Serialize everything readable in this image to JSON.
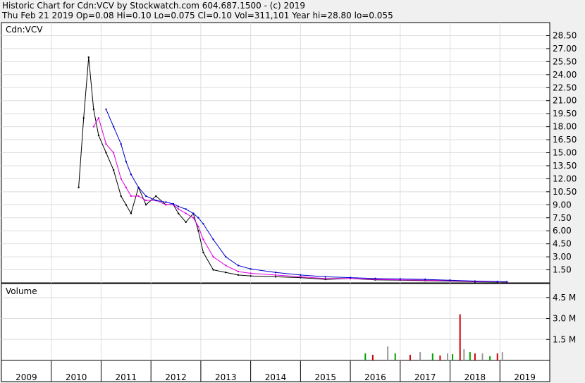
{
  "header": {
    "title": "Historic Chart for Cdn:VCV by Stockwatch.com 604.687.1500 - (c) 2019",
    "quote": "Thu Feb 21 2019   Op=0.08   Hi=0.10   Lo=0.075   Cl=0.10   Vol=311,101   Year hi=28.80   lo=0.055"
  },
  "chart_data": [
    {
      "type": "line",
      "panel": "price",
      "title": "Cdn:VCV",
      "ylim": [
        0,
        30
      ],
      "yticks": [
        "1.50",
        "3.00",
        "4.50",
        "6.00",
        "7.50",
        "9.00",
        "10.50",
        "12.00",
        "13.50",
        "15.00",
        "16.50",
        "18.00",
        "19.50",
        "21.00",
        "22.50",
        "24.00",
        "25.50",
        "27.00",
        "28.50"
      ],
      "x": [
        2010.55,
        2010.65,
        2010.75,
        2010.85,
        2010.95,
        2011.1,
        2011.25,
        2011.4,
        2011.5,
        2011.6,
        2011.75,
        2011.9,
        2012.1,
        2012.3,
        2012.45,
        2012.55,
        2012.7,
        2012.85,
        2012.95,
        2013.05,
        2013.25,
        2013.5,
        2013.75,
        2014.0,
        2014.5,
        2015.0,
        2015.5,
        2016.0,
        2016.5,
        2017.0,
        2017.5,
        2018.0,
        2018.5,
        2018.95,
        2019.14
      ],
      "series": [
        {
          "values": [
            11,
            19,
            26,
            20,
            17,
            15,
            13,
            10,
            9,
            8,
            11,
            9,
            10,
            9,
            9,
            8,
            7,
            8,
            6,
            3.5,
            1.5,
            1.2,
            0.9,
            0.8,
            0.7,
            0.6,
            0.4,
            0.5,
            0.35,
            0.3,
            0.25,
            0.2,
            0.12,
            0.1,
            0.1
          ]
        },
        {
          "values": [
            null,
            null,
            null,
            18,
            19,
            16,
            15,
            12,
            11,
            10,
            10,
            9.5,
            9.5,
            9,
            9,
            8.5,
            8,
            7.5,
            6.5,
            5,
            3,
            2,
            1.3,
            1.1,
            0.9,
            0.7,
            0.5,
            0.5,
            0.4,
            0.35,
            0.3,
            0.25,
            0.15,
            0.12,
            0.1
          ]
        },
        {
          "values": [
            null,
            null,
            null,
            null,
            null,
            20,
            18,
            16,
            14,
            12.5,
            11,
            10,
            9.5,
            9.3,
            9.1,
            8.8,
            8.5,
            8,
            7.5,
            6.8,
            5,
            3,
            2,
            1.6,
            1.2,
            0.9,
            0.7,
            0.6,
            0.5,
            0.45,
            0.4,
            0.3,
            0.2,
            0.15,
            0.12
          ]
        }
      ]
    },
    {
      "type": "bar",
      "panel": "volume",
      "title": "Volume",
      "ylim": [
        0,
        5.5
      ],
      "yticks": [
        "1.5 M",
        "3.0 M",
        "4.5 M"
      ],
      "x": [
        2016.3,
        2016.45,
        2016.75,
        2016.9,
        2017.2,
        2017.4,
        2017.65,
        2017.8,
        2017.95,
        2018.05,
        2018.2,
        2018.28,
        2018.4,
        2018.5,
        2018.65,
        2018.8,
        2018.95,
        2019.05
      ],
      "values": [
        0.5,
        0.4,
        1.0,
        0.5,
        0.4,
        0.6,
        0.5,
        0.35,
        0.5,
        0.45,
        3.3,
        0.8,
        0.6,
        0.5,
        0.5,
        0.3,
        0.5,
        0.6
      ]
    }
  ],
  "x_axis": {
    "labels": [
      "2009",
      "2010",
      "2011",
      "2012",
      "2013",
      "2014",
      "2015",
      "2016",
      "2017",
      "2018",
      "2019"
    ]
  },
  "colors": {
    "price_line": "#000000",
    "short_ma": "#e000e0",
    "long_ma": "#0000cc",
    "down": "#cc0000",
    "volume_up": "#00a000",
    "volume_down": "#cc0000",
    "volume_neutral": "#999999",
    "grid": "#dddddd"
  }
}
